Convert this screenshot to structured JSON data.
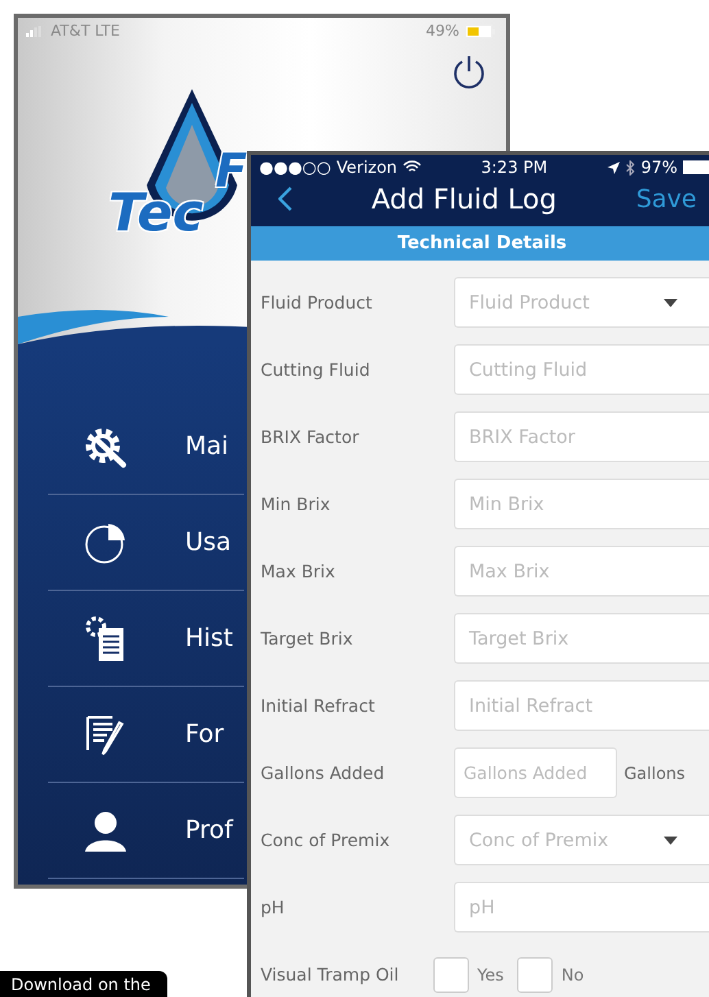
{
  "back_screen": {
    "status_bar": {
      "carrier": "AT&T LTE",
      "battery": "49%"
    },
    "logo": {
      "line_1": "F",
      "line_2": "Tec"
    },
    "menu": [
      {
        "label": "Mai"
      },
      {
        "label": "Usa"
      },
      {
        "label": "Hist"
      },
      {
        "label": "For"
      },
      {
        "label": "Prof"
      }
    ]
  },
  "front_screen": {
    "status_bar": {
      "signal": "●●●○○",
      "carrier": "Verizon",
      "time": "3:23 PM",
      "battery": "97%"
    },
    "nav": {
      "title": "Add Fluid Log",
      "action": "Save"
    },
    "section": "Technical Details",
    "fields": [
      {
        "kind": "dropdown",
        "label": "Fluid Product",
        "placeholder": "Fluid Product"
      },
      {
        "kind": "text",
        "label": "Cutting Fluid",
        "placeholder": "Cutting Fluid"
      },
      {
        "kind": "text",
        "label": "BRIX Factor",
        "placeholder": "BRIX Factor"
      },
      {
        "kind": "text",
        "label": "Min Brix",
        "placeholder": "Min Brix"
      },
      {
        "kind": "text",
        "label": "Max Brix",
        "placeholder": "Max Brix"
      },
      {
        "kind": "text",
        "label": "Target Brix",
        "placeholder": "Target Brix"
      },
      {
        "kind": "text",
        "label": "Initial Refract",
        "placeholder": "Initial Refract"
      },
      {
        "kind": "unit",
        "label": "Gallons Added",
        "placeholder": "Gallons Added",
        "unit": "Gallons"
      },
      {
        "kind": "dropdown",
        "label": "Conc of Premix",
        "placeholder": "Conc of Premix"
      },
      {
        "kind": "text",
        "label": "pH",
        "placeholder": "pH"
      },
      {
        "kind": "checkboxes",
        "label": "Visual Tramp Oil",
        "options": [
          {
            "label": "Yes",
            "checked": false
          },
          {
            "label": "No",
            "checked": false
          }
        ]
      }
    ]
  },
  "badge": "Download on the"
}
